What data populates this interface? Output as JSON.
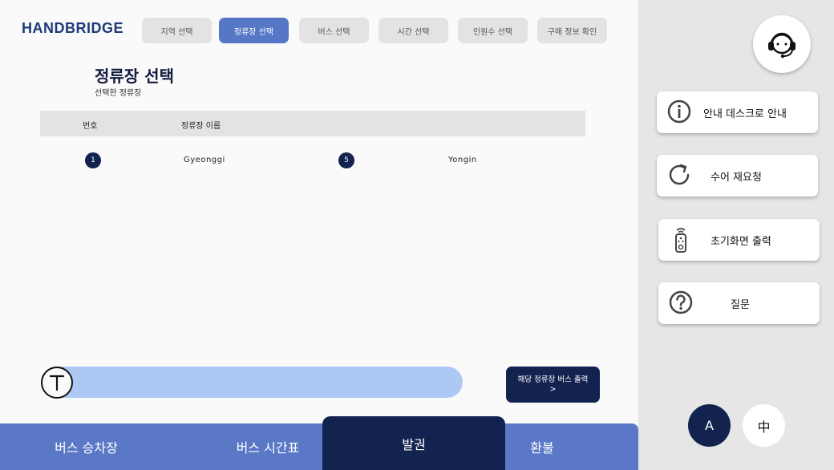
{
  "brand": {
    "logo": "HANDBRIDGE"
  },
  "steps": [
    {
      "label": "지역 선택",
      "active": false
    },
    {
      "label": "정류장 선택",
      "active": true
    },
    {
      "label": "버스 선택",
      "active": false
    },
    {
      "label": "시간 선택",
      "active": false
    },
    {
      "label": "인원수 선택",
      "active": false
    },
    {
      "label": "구매 정보 확인",
      "active": false
    }
  ],
  "page": {
    "title": "정류장 선택",
    "subtitle": "선택한 정류장"
  },
  "table": {
    "headers": [
      "번호",
      "정류장 이름"
    ],
    "rows": [
      {
        "num1": "1",
        "name1": "Gyeonggi",
        "num2": "5",
        "name2": "Yongin"
      }
    ]
  },
  "input": {
    "icon": "text-icon",
    "value": ""
  },
  "action": {
    "print_label": "해당 정류장 버스 출력 >"
  },
  "bottom_tabs": [
    {
      "label": "버스 승차장",
      "active": false
    },
    {
      "label": "버스 시간표",
      "active": false
    },
    {
      "label": "발권",
      "active": true
    },
    {
      "label": "환불",
      "active": false
    }
  ],
  "side": {
    "help_icon": "headset-icon",
    "cards": [
      {
        "label": "안내 데스크로 안내",
        "icon": "info-icon"
      },
      {
        "label": "수어 재요청",
        "icon": "refresh-icon"
      },
      {
        "label": "초기화면 출력",
        "icon": "remote-icon"
      },
      {
        "label": "질문",
        "icon": "question-icon"
      }
    ],
    "languages": [
      {
        "label": "A",
        "active": true
      },
      {
        "label": "中",
        "active": false
      }
    ]
  },
  "colors": {
    "navy": "#13234f",
    "accent": "#5a78c6",
    "step_active": "#5577c6",
    "input_bar": "#adc9f3"
  }
}
